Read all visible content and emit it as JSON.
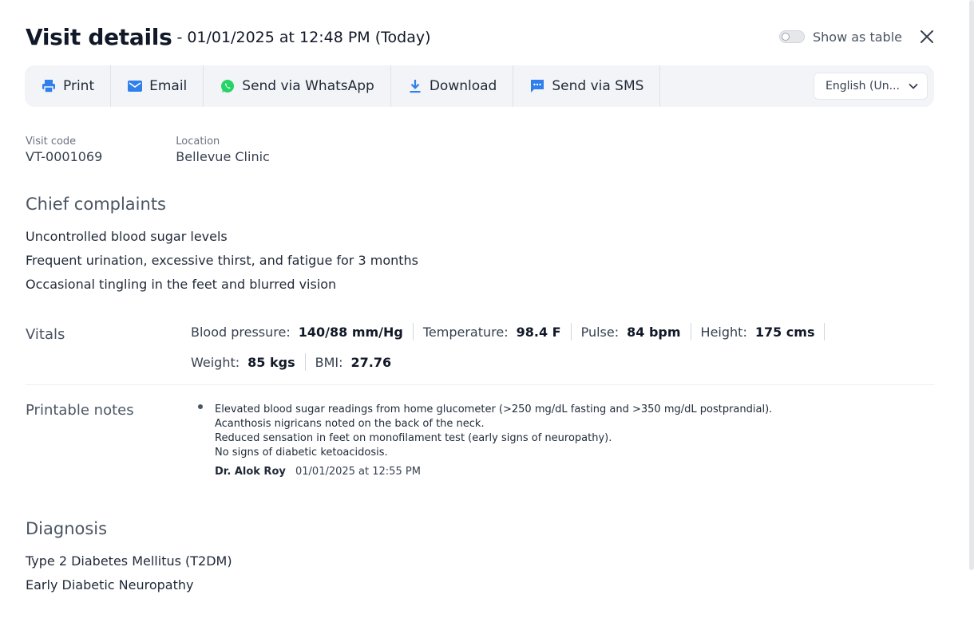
{
  "header": {
    "title": "Visit details",
    "subtitle": "- 01/01/2025 at 12:48 PM (Today)",
    "toggle_label": "Show as table"
  },
  "toolbar": {
    "print": "Print",
    "email": "Email",
    "whatsapp": "Send via WhatsApp",
    "download": "Download",
    "sms": "Send via SMS",
    "language": "English (Un..."
  },
  "meta": {
    "visit_code_label": "Visit code",
    "visit_code": "VT-0001069",
    "location_label": "Location",
    "location": "Bellevue Clinic"
  },
  "chief_complaints": {
    "title": "Chief complaints",
    "items": [
      "Uncontrolled blood sugar levels",
      "Frequent urination, excessive thirst, and fatigue for 3 months",
      "Occasional tingling in the feet and blurred vision"
    ]
  },
  "vitals": {
    "title": "Vitals",
    "items": [
      {
        "name": "Blood pressure:",
        "value": "140/88 mm/Hg"
      },
      {
        "name": "Temperature:",
        "value": "98.4 F"
      },
      {
        "name": "Pulse:",
        "value": "84 bpm"
      },
      {
        "name": "Height:",
        "value": "175 cms"
      },
      {
        "name": "Weight:",
        "value": "85 kgs"
      },
      {
        "name": "BMI:",
        "value": "27.76"
      }
    ]
  },
  "notes": {
    "title": "Printable notes",
    "lines": [
      "Elevated blood sugar readings from home glucometer (>250 mg/dL fasting and >350 mg/dL postprandial).",
      "Acanthosis nigricans noted on the back of the neck.",
      "Reduced sensation in feet on monofilament test (early signs of neuropathy).",
      "No signs of diabetic ketoacidosis."
    ],
    "author": "Dr. Alok Roy",
    "timestamp": "01/01/2025 at 12:55 PM"
  },
  "diagnosis": {
    "title": "Diagnosis",
    "items": [
      "Type 2 Diabetes Mellitus (T2DM)",
      "Early Diabetic Neuropathy"
    ]
  },
  "colors": {
    "accent": "#2f80ed",
    "whatsapp": "#25d366",
    "toolbar_bg": "#f3f4f7"
  }
}
